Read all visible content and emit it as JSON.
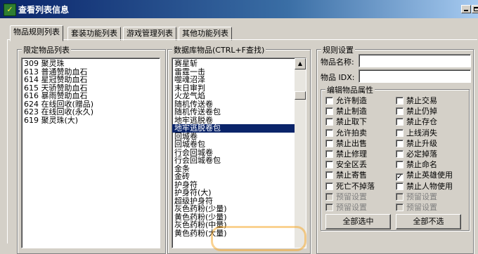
{
  "window": {
    "title": "查看列表信息",
    "icon": "app-icon"
  },
  "tabs": [
    {
      "label": "物品规则列表"
    },
    {
      "label": "套装功能列表"
    },
    {
      "label": "游戏管理列表"
    },
    {
      "label": "其他功能列表"
    }
  ],
  "limited_items": {
    "label": "限定物品列表",
    "items": [
      "309  聚灵珠",
      "613  普通赞助血石",
      "614  星冠赞助血石",
      "615  天骄赞助血石",
      "616  暴雨赞助血石",
      "624  在线回收(赠品)",
      "623  在线回收(永久)",
      "619  聚灵珠(大)"
    ]
  },
  "db_items": {
    "label": "数据库物品(CTRL+F查找)",
    "selected_index": 8,
    "items": [
      "赛星斩",
      "雷霆一击",
      "噬魂沼泽",
      "末日审判",
      "火龙气焰",
      "随机传送卷",
      "随机传送卷包",
      "地牢逃脱卷",
      "地牢逃脱卷包",
      "回城卷",
      "回城卷包",
      "行会回城卷",
      "行会回城卷包",
      "金条",
      "金砖",
      "护身符",
      "护身符(大)",
      "超级护身符",
      "灰色药粉(少量)",
      "黄色药粉(少量)",
      "灰色药粉(中量)",
      "黄色药粉(大量)"
    ]
  },
  "rules": {
    "label": "规则设置",
    "name_label": "物品名称:",
    "name_value": "",
    "idx_label": "物品 IDX:",
    "idx_value": ""
  },
  "props": {
    "label": "编辑物品属性",
    "left": [
      {
        "label": "允许制造",
        "checked": false,
        "disabled": false
      },
      {
        "label": "禁止制造",
        "checked": false,
        "disabled": false
      },
      {
        "label": "禁止取下",
        "checked": false,
        "disabled": false
      },
      {
        "label": "允许拍卖",
        "checked": false,
        "disabled": false
      },
      {
        "label": "禁止出售",
        "checked": false,
        "disabled": false
      },
      {
        "label": "禁止修理",
        "checked": false,
        "disabled": false
      },
      {
        "label": "安全区丢",
        "checked": false,
        "disabled": false
      },
      {
        "label": "禁止寄售",
        "checked": false,
        "disabled": false
      },
      {
        "label": "死亡不掉落",
        "checked": false,
        "disabled": false
      },
      {
        "label": "预留设置",
        "checked": false,
        "disabled": true
      },
      {
        "label": "预留设置",
        "checked": false,
        "disabled": true
      }
    ],
    "right": [
      {
        "label": "禁止交易",
        "checked": false,
        "disabled": false
      },
      {
        "label": "禁止仍掉",
        "checked": false,
        "disabled": false
      },
      {
        "label": "禁止存仓",
        "checked": false,
        "disabled": false
      },
      {
        "label": "上线消失",
        "checked": false,
        "disabled": false
      },
      {
        "label": "禁止升级",
        "checked": false,
        "disabled": false
      },
      {
        "label": "必定掉落",
        "checked": false,
        "disabled": false
      },
      {
        "label": "禁止命名",
        "checked": false,
        "disabled": false
      },
      {
        "label": "禁止英雄使用",
        "checked": true,
        "disabled": false
      },
      {
        "label": "禁止人物使用",
        "checked": false,
        "disabled": false
      },
      {
        "label": "预留设置",
        "checked": false,
        "disabled": true
      },
      {
        "label": "预留设置",
        "checked": false,
        "disabled": true
      }
    ],
    "select_all": "全部选中",
    "select_none": "全部不选"
  }
}
